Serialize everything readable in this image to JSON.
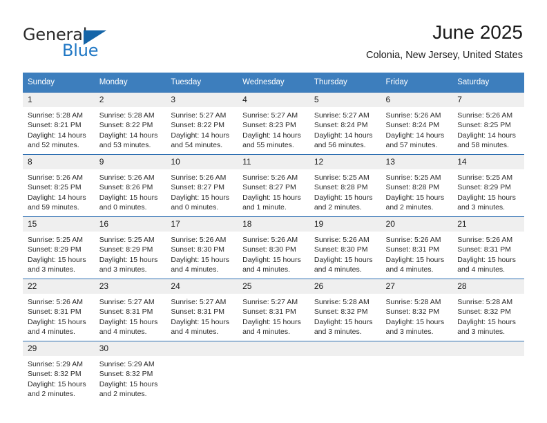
{
  "brand": {
    "name_top": "General",
    "name_bottom": "Blue",
    "top_color": "#2b2b2b",
    "bottom_color": "#1f77c4",
    "triangle_color": "#1565a8"
  },
  "header": {
    "title": "June 2025",
    "subtitle": "Colonia, New Jersey, United States"
  },
  "theme": {
    "header_row_bg": "#3d7ebd",
    "header_row_text": "#ffffff",
    "daynum_bg": "#efefef",
    "row_divider": "#2a6cb0",
    "cell_bg": "#ffffff"
  },
  "weekday_headers": [
    "Sunday",
    "Monday",
    "Tuesday",
    "Wednesday",
    "Thursday",
    "Friday",
    "Saturday"
  ],
  "weeks": [
    [
      {
        "day": "1",
        "sunrise": "Sunrise: 5:28 AM",
        "sunset": "Sunset: 8:21 PM",
        "daylight": "Daylight: 14 hours and 52 minutes."
      },
      {
        "day": "2",
        "sunrise": "Sunrise: 5:28 AM",
        "sunset": "Sunset: 8:22 PM",
        "daylight": "Daylight: 14 hours and 53 minutes."
      },
      {
        "day": "3",
        "sunrise": "Sunrise: 5:27 AM",
        "sunset": "Sunset: 8:22 PM",
        "daylight": "Daylight: 14 hours and 54 minutes."
      },
      {
        "day": "4",
        "sunrise": "Sunrise: 5:27 AM",
        "sunset": "Sunset: 8:23 PM",
        "daylight": "Daylight: 14 hours and 55 minutes."
      },
      {
        "day": "5",
        "sunrise": "Sunrise: 5:27 AM",
        "sunset": "Sunset: 8:24 PM",
        "daylight": "Daylight: 14 hours and 56 minutes."
      },
      {
        "day": "6",
        "sunrise": "Sunrise: 5:26 AM",
        "sunset": "Sunset: 8:24 PM",
        "daylight": "Daylight: 14 hours and 57 minutes."
      },
      {
        "day": "7",
        "sunrise": "Sunrise: 5:26 AM",
        "sunset": "Sunset: 8:25 PM",
        "daylight": "Daylight: 14 hours and 58 minutes."
      }
    ],
    [
      {
        "day": "8",
        "sunrise": "Sunrise: 5:26 AM",
        "sunset": "Sunset: 8:25 PM",
        "daylight": "Daylight: 14 hours and 59 minutes."
      },
      {
        "day": "9",
        "sunrise": "Sunrise: 5:26 AM",
        "sunset": "Sunset: 8:26 PM",
        "daylight": "Daylight: 15 hours and 0 minutes."
      },
      {
        "day": "10",
        "sunrise": "Sunrise: 5:26 AM",
        "sunset": "Sunset: 8:27 PM",
        "daylight": "Daylight: 15 hours and 0 minutes."
      },
      {
        "day": "11",
        "sunrise": "Sunrise: 5:26 AM",
        "sunset": "Sunset: 8:27 PM",
        "daylight": "Daylight: 15 hours and 1 minute."
      },
      {
        "day": "12",
        "sunrise": "Sunrise: 5:25 AM",
        "sunset": "Sunset: 8:28 PM",
        "daylight": "Daylight: 15 hours and 2 minutes."
      },
      {
        "day": "13",
        "sunrise": "Sunrise: 5:25 AM",
        "sunset": "Sunset: 8:28 PM",
        "daylight": "Daylight: 15 hours and 2 minutes."
      },
      {
        "day": "14",
        "sunrise": "Sunrise: 5:25 AM",
        "sunset": "Sunset: 8:29 PM",
        "daylight": "Daylight: 15 hours and 3 minutes."
      }
    ],
    [
      {
        "day": "15",
        "sunrise": "Sunrise: 5:25 AM",
        "sunset": "Sunset: 8:29 PM",
        "daylight": "Daylight: 15 hours and 3 minutes."
      },
      {
        "day": "16",
        "sunrise": "Sunrise: 5:25 AM",
        "sunset": "Sunset: 8:29 PM",
        "daylight": "Daylight: 15 hours and 3 minutes."
      },
      {
        "day": "17",
        "sunrise": "Sunrise: 5:26 AM",
        "sunset": "Sunset: 8:30 PM",
        "daylight": "Daylight: 15 hours and 4 minutes."
      },
      {
        "day": "18",
        "sunrise": "Sunrise: 5:26 AM",
        "sunset": "Sunset: 8:30 PM",
        "daylight": "Daylight: 15 hours and 4 minutes."
      },
      {
        "day": "19",
        "sunrise": "Sunrise: 5:26 AM",
        "sunset": "Sunset: 8:30 PM",
        "daylight": "Daylight: 15 hours and 4 minutes."
      },
      {
        "day": "20",
        "sunrise": "Sunrise: 5:26 AM",
        "sunset": "Sunset: 8:31 PM",
        "daylight": "Daylight: 15 hours and 4 minutes."
      },
      {
        "day": "21",
        "sunrise": "Sunrise: 5:26 AM",
        "sunset": "Sunset: 8:31 PM",
        "daylight": "Daylight: 15 hours and 4 minutes."
      }
    ],
    [
      {
        "day": "22",
        "sunrise": "Sunrise: 5:26 AM",
        "sunset": "Sunset: 8:31 PM",
        "daylight": "Daylight: 15 hours and 4 minutes."
      },
      {
        "day": "23",
        "sunrise": "Sunrise: 5:27 AM",
        "sunset": "Sunset: 8:31 PM",
        "daylight": "Daylight: 15 hours and 4 minutes."
      },
      {
        "day": "24",
        "sunrise": "Sunrise: 5:27 AM",
        "sunset": "Sunset: 8:31 PM",
        "daylight": "Daylight: 15 hours and 4 minutes."
      },
      {
        "day": "25",
        "sunrise": "Sunrise: 5:27 AM",
        "sunset": "Sunset: 8:31 PM",
        "daylight": "Daylight: 15 hours and 4 minutes."
      },
      {
        "day": "26",
        "sunrise": "Sunrise: 5:28 AM",
        "sunset": "Sunset: 8:32 PM",
        "daylight": "Daylight: 15 hours and 3 minutes."
      },
      {
        "day": "27",
        "sunrise": "Sunrise: 5:28 AM",
        "sunset": "Sunset: 8:32 PM",
        "daylight": "Daylight: 15 hours and 3 minutes."
      },
      {
        "day": "28",
        "sunrise": "Sunrise: 5:28 AM",
        "sunset": "Sunset: 8:32 PM",
        "daylight": "Daylight: 15 hours and 3 minutes."
      }
    ],
    [
      {
        "day": "29",
        "sunrise": "Sunrise: 5:29 AM",
        "sunset": "Sunset: 8:32 PM",
        "daylight": "Daylight: 15 hours and 2 minutes."
      },
      {
        "day": "30",
        "sunrise": "Sunrise: 5:29 AM",
        "sunset": "Sunset: 8:32 PM",
        "daylight": "Daylight: 15 hours and 2 minutes."
      },
      {
        "day": "",
        "sunrise": "",
        "sunset": "",
        "daylight": ""
      },
      {
        "day": "",
        "sunrise": "",
        "sunset": "",
        "daylight": ""
      },
      {
        "day": "",
        "sunrise": "",
        "sunset": "",
        "daylight": ""
      },
      {
        "day": "",
        "sunrise": "",
        "sunset": "",
        "daylight": ""
      },
      {
        "day": "",
        "sunrise": "",
        "sunset": "",
        "daylight": ""
      }
    ]
  ]
}
